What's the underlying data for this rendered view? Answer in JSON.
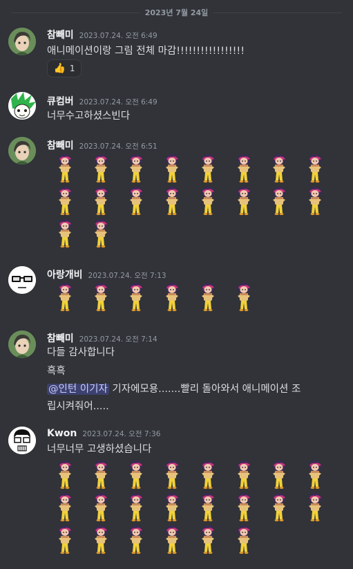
{
  "divider": {
    "label": "2023년 7월 24일"
  },
  "messages": [
    {
      "author": "참빼미",
      "time": "2023.07.24. 오전 6:49",
      "lines": [
        "애니메이션이랑 그림 전체 마감!!!!!!!!!!!!!!!!!"
      ],
      "reaction": {
        "emoji": "👍",
        "count": "1"
      }
    },
    {
      "author": "큐컴버",
      "time": "2023.07.24. 오전 6:49",
      "lines": [
        "너무수고하셨스빈다"
      ]
    },
    {
      "author": "참빼미",
      "time": "2023.07.24. 오전 6:51",
      "stickers": 18
    },
    {
      "author": "아랑개비",
      "time": "2023.07.24. 오전 7:13",
      "stickers": 6
    },
    {
      "author": "참빼미",
      "time": "2023.07.24. 오전 7:14",
      "lines": [
        "다들 감사합니다",
        "흑흑"
      ],
      "mention": "@인턴 이기자",
      "after_mention": " 기자에모용.......빨리 돌아와서 애니메이션 조",
      "wrap": "립시켜줘어....."
    },
    {
      "author": "Kwon",
      "time": "2023.07.24. 오전 7:36",
      "lines": [
        "너무너무 고생하셨습니다"
      ],
      "stickers": 22
    }
  ],
  "colors": {
    "bg": "#313338",
    "mention_bg": "#3c4270",
    "text": "#dbdee1",
    "muted": "#949ba4"
  }
}
